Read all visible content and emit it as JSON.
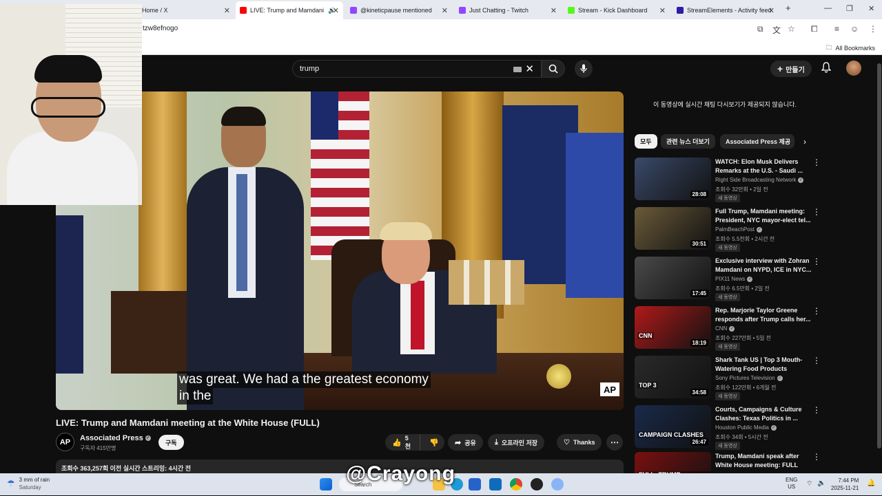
{
  "browser": {
    "tabs": [
      {
        "label": "Home / X",
        "favicon_color": "#000000"
      },
      {
        "label": "LIVE: Trump and Mamdani",
        "favicon_color": "#ff0000",
        "active": true
      },
      {
        "label": "@kineticpause mentioned",
        "favicon_color": "#9146ff"
      },
      {
        "label": "Just Chatting - Twitch",
        "favicon_color": "#9146ff"
      },
      {
        "label": "Stream - Kick Dashboard",
        "favicon_color": "#53fc18"
      },
      {
        "label": "StreamElements - Activity feed",
        "favicon_color": "#2e1ba8"
      }
    ],
    "new_tab": "+",
    "url": "tzw8efnogo",
    "all_bookmarks": "All Bookmarks"
  },
  "youtube": {
    "search_value": "trump",
    "create_label": "만들기",
    "video": {
      "caption_line1": "was great. We had a the greatest economy",
      "caption_line2": "in the",
      "corner_logo": "AP"
    },
    "title": "LIVE: Trump and Mamdani meeting at the White House (FULL)",
    "channel": {
      "avatar_text": "AP",
      "name": "Associated Press",
      "subscribers": "구독자 415만명",
      "subscribe_label": "구독"
    },
    "actions": {
      "likes": "5천",
      "share": "공유",
      "download": "오프라인 저장",
      "thanks": "Thanks"
    },
    "description": "조회수 363,257회  이전 실시간 스트리밍: 4시간 전",
    "sidebar": {
      "live_chat_notice": "이 동영상에 실시간 채팅 다시보기가 제공되지 않습니다.",
      "chips": [
        "모두",
        "관련 뉴스 더보기",
        "Associated Press 제공"
      ],
      "new_badge": "새 동영상",
      "recommendations": [
        {
          "title": "WATCH: Elon Musk Delivers Remarks at the U.S. - Saudi ...",
          "channel": "Right Side Broadcasting Network",
          "meta": "조회수 32만회 • 2일 전",
          "duration": "28:08",
          "thumb_color": "#3a4a6a"
        },
        {
          "title": "Full Trump, Mamdani meeting: President, NYC mayor-elect tel...",
          "channel": "PalmBeachPost",
          "meta": "조회수 5.5천회 • 2시간 전",
          "duration": "30:51",
          "thumb_color": "#6a5a3a"
        },
        {
          "title": "Exclusive interview with Zohran Mamdani on NYPD, ICE in NYC...",
          "channel": "PIX11 News",
          "meta": "조회수 6.5만회 • 2일 전",
          "duration": "17:45",
          "thumb_color": "#4a4a4a"
        },
        {
          "title": "Rep. Marjorie Taylor Greene responds after Trump calls her...",
          "channel": "CNN",
          "meta": "조회수 227만회 • 5일 전",
          "duration": "18:19",
          "thumb_color": "#b01a1a",
          "thumb_text": "CNN"
        },
        {
          "title": "Shark Tank US | Top 3 Mouth-Watering Food Products",
          "channel": "Sony Pictures Television",
          "meta": "조회수 122만회 • 6개월 전",
          "duration": "34:58",
          "thumb_color": "#2a2a2a",
          "thumb_text": "TOP 3"
        },
        {
          "title": "Courts, Campaigns & Culture Clashes: Texas Politics in ...",
          "channel": "Houston Public Media",
          "meta": "조회수 34회 • 5시간 전",
          "duration": "26:47",
          "thumb_color": "#1a2a4a",
          "thumb_text": "CAMPAIGN CLASHES"
        },
        {
          "title": "Trump, Mamdani speak after White House meeting: FULL",
          "channel": "",
          "meta": "",
          "duration": "",
          "thumb_color": "#7a1010",
          "thumb_text": "FULL: TRUMP, MAMDANI"
        }
      ]
    }
  },
  "taskbar": {
    "weather_line1": "3 mm of rain",
    "weather_line2": "Saturday",
    "search_label": "Search",
    "lang_line1": "ENG",
    "lang_line2": "US",
    "time": "7:44 PM",
    "date": "2025-11-21"
  },
  "watermark": "@Crayong"
}
